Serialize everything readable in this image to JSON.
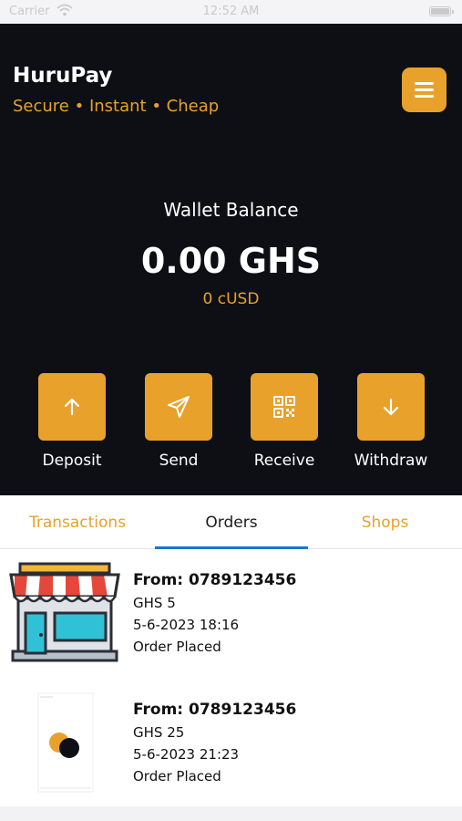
{
  "status_bar": {
    "carrier": "Carrier",
    "time": "12:52 AM"
  },
  "header": {
    "title": "HuruPay",
    "tagline": "Secure • Instant • Cheap"
  },
  "balance": {
    "label": "Wallet Balance",
    "value": "0.00 GHS",
    "sub": "0 cUSD"
  },
  "actions": [
    {
      "label": "Deposit",
      "icon": "arrow-up-icon"
    },
    {
      "label": "Send",
      "icon": "send-icon"
    },
    {
      "label": "Receive",
      "icon": "qr-code-icon"
    },
    {
      "label": "Withdraw",
      "icon": "arrow-down-icon"
    }
  ],
  "tabs": [
    {
      "label": "Transactions",
      "active": false
    },
    {
      "label": "Orders",
      "active": true
    },
    {
      "label": "Shops",
      "active": false
    }
  ],
  "orders": [
    {
      "from": "From: 0789123456",
      "amount": "GHS 5",
      "date": "5-6-2023 18:16",
      "status": "Order Placed",
      "thumbnail": "shop-storefront"
    },
    {
      "from": "From: 0789123456",
      "amount": "GHS 25",
      "date": "5-6-2023 21:23",
      "status": "Order Placed",
      "thumbnail": "product-screenshot"
    }
  ],
  "colors": {
    "accent": "#e8a12a",
    "header_bg": "#0d0f15",
    "tab_indicator": "#1677cc"
  }
}
